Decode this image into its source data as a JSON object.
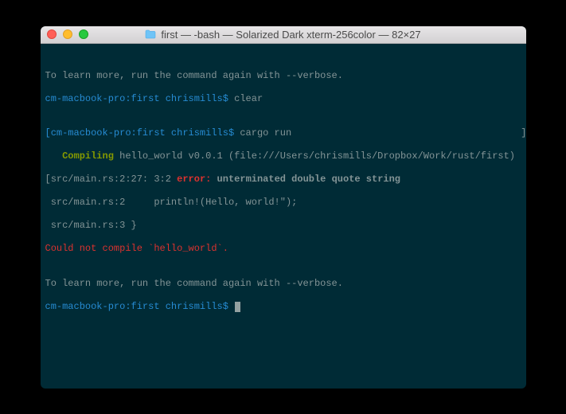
{
  "window": {
    "title": "first — -bash — Solarized Dark xterm-256color — 82×27"
  },
  "lines": {
    "l0": "",
    "l1": "To learn more, run the command again with --verbose.",
    "l2_prompt": "cm-macbook-pro:first chrismills$ ",
    "l2_cmd": "clear",
    "l3": "",
    "l4_prompt": "[cm-macbook-pro:first chrismills$ ",
    "l4_cmd": "cargo run",
    "l4_end": "                                        ]",
    "l5_compiling": "   Compiling",
    "l5_rest": " hello_world v0.0.1 (file:///Users/chrismills/Dropbox/Work/rust/first)",
    "l6_loc": "[src/main.rs:2:27: 3:2 ",
    "l6_err": "error:",
    "l6_msg": " unterminated double quote string",
    "l6_end": "                       ]",
    "l7": " src/main.rs:2     println!(Hello, world!\");",
    "l8": " src/main.rs:3 }",
    "l9_a": "Could not compile ",
    "l9_b": "`hello_world`",
    "l9_c": ".",
    "l10": "",
    "l11": "To learn more, run the command again with --verbose.",
    "l12_prompt": "cm-macbook-pro:first chrismills$ "
  }
}
